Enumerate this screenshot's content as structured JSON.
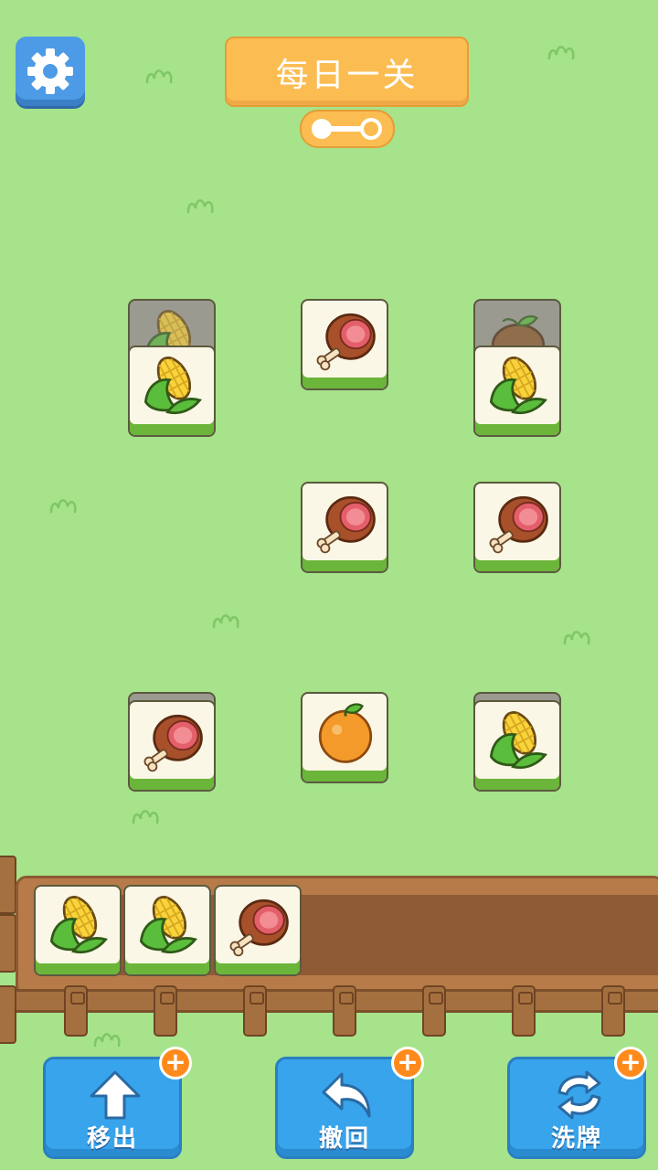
{
  "header": {
    "title": "每日一关"
  },
  "icons": {
    "settings": "gear-icon",
    "key": "key-icon",
    "corn": "corn-icon",
    "ham": "ham-icon",
    "orange": "orange-icon",
    "kiwi": "brown-fruit-icon"
  },
  "board": {
    "tiles": [
      {
        "item": "corn",
        "covered": true
      },
      {
        "item": "corn",
        "covered": false
      },
      {
        "item": "ham",
        "covered": false
      },
      {
        "item": "kiwi",
        "covered": true
      },
      {
        "item": "corn",
        "covered": false
      },
      {
        "item": "ham",
        "covered": false
      },
      {
        "item": "ham",
        "covered": false
      },
      {
        "item": "ham",
        "covered": false
      },
      {
        "item": "orange",
        "covered": false
      },
      {
        "item": "corn",
        "covered": false
      }
    ]
  },
  "tray": {
    "slots": [
      "corn",
      "corn",
      "ham"
    ]
  },
  "tools": {
    "move_out": "移出",
    "undo": "撤回",
    "shuffle": "洗牌",
    "badge": "+"
  },
  "colors": {
    "grass": "#a6e38a",
    "tool_button": "#38a4ec",
    "banner": "#fbbd52",
    "badge": "#ff8a1c"
  }
}
